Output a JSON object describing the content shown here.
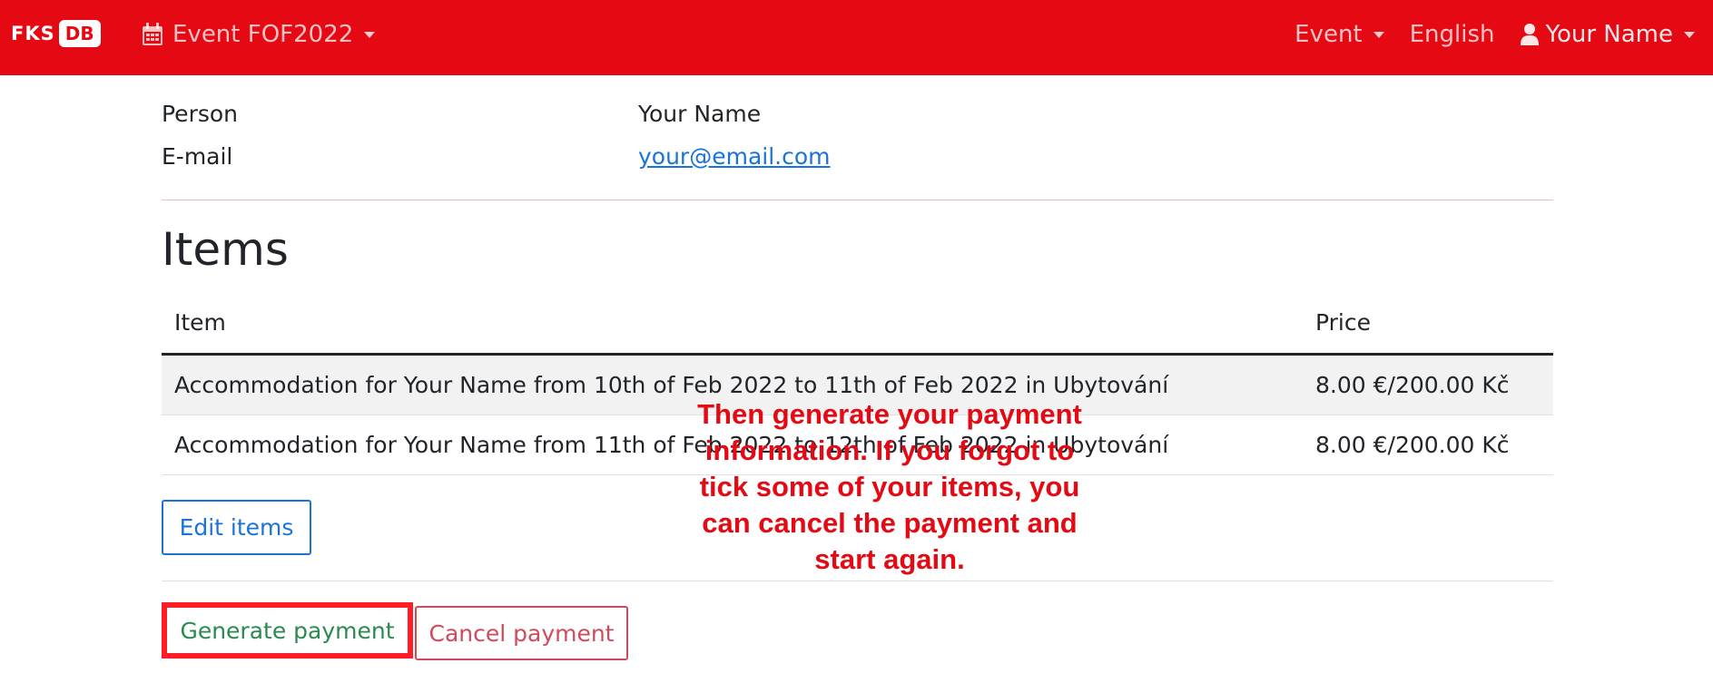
{
  "navbar": {
    "brand_fks": "FKS",
    "brand_db": "DB",
    "event_selector": "Event FOF2022",
    "menu_event": "Event",
    "menu_language": "English",
    "menu_user": "Your Name"
  },
  "person": {
    "person_label": "Person",
    "person_value": "Your Name",
    "email_label": "E-mail",
    "email_value": "your@email.com"
  },
  "items": {
    "title": "Items",
    "headers": {
      "item": "Item",
      "price": "Price"
    },
    "rows": [
      {
        "item": "Accommodation for Your Name from 10th of Feb 2022 to 11th of Feb 2022 in Ubytování",
        "price": "8.00 €/200.00 Kč"
      },
      {
        "item": "Accommodation for Your Name from 11th of Feb 2022 to 12th of Feb 2022 in Ubytování",
        "price": "8.00 €/200.00 Kč"
      }
    ],
    "edit_button": "Edit items"
  },
  "actions": {
    "generate_button": "Generate payment",
    "cancel_button": "Cancel payment"
  },
  "annotation": {
    "lines": [
      "Then generate your payment",
      "information. If you forgot to",
      "tick some of your items, you",
      "can cancel the payment and",
      "start again."
    ]
  },
  "colors": {
    "navbar": "#e50914",
    "link": "#1a73d9",
    "success": "#2b8a4f",
    "danger": "#d14a5b",
    "highlight": "#ff1e25"
  }
}
